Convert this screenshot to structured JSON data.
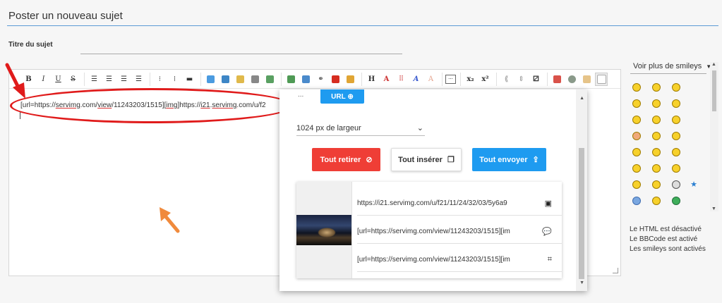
{
  "page": {
    "title": "Poster un nouveau sujet",
    "subject_label": "Titre du sujet",
    "subject_value": ""
  },
  "editor": {
    "content_prefix": "[url=https://",
    "content_parts": [
      "servimg",
      ".com/",
      "view",
      "/11243203/1515][",
      "img",
      "]https://",
      "i21",
      ".",
      "servimg",
      ".com/u/f2"
    ],
    "toolbar_text_buttons": {
      "bold": "B",
      "italic": "I",
      "underline": "U",
      "strike": "S",
      "h": "H",
      "sub": "x₂",
      "sup": "x²"
    }
  },
  "popup": {
    "partial_label": "...",
    "url_button_partial": "URL",
    "size_select": "1024 px de largeur",
    "btn_remove": "Tout retirer",
    "btn_insert": "Tout insérer",
    "btn_send": "Tout envoyer",
    "links": [
      {
        "text": "https://i21.servimg.com/u/f21/11/24/32/03/5y6a9",
        "icon": "image-icon"
      },
      {
        "text": "[url=https://servimg.com/view/11243203/1515][im",
        "icon": "comments-icon"
      },
      {
        "text": "[url=https://servimg.com/view/11243203/1515][im",
        "icon": "crop-icon"
      }
    ]
  },
  "smileys": {
    "header": "Voir plus de smileys",
    "info": [
      "Le HTML est désactivé",
      "Le BBCode est activé",
      "Les smileys sont activés"
    ]
  },
  "colors": {
    "accent_blue": "#1e9bf0",
    "danger_red": "#ef3e36",
    "annotation_red": "#e01b1b",
    "annotation_orange": "#f08a3c"
  }
}
